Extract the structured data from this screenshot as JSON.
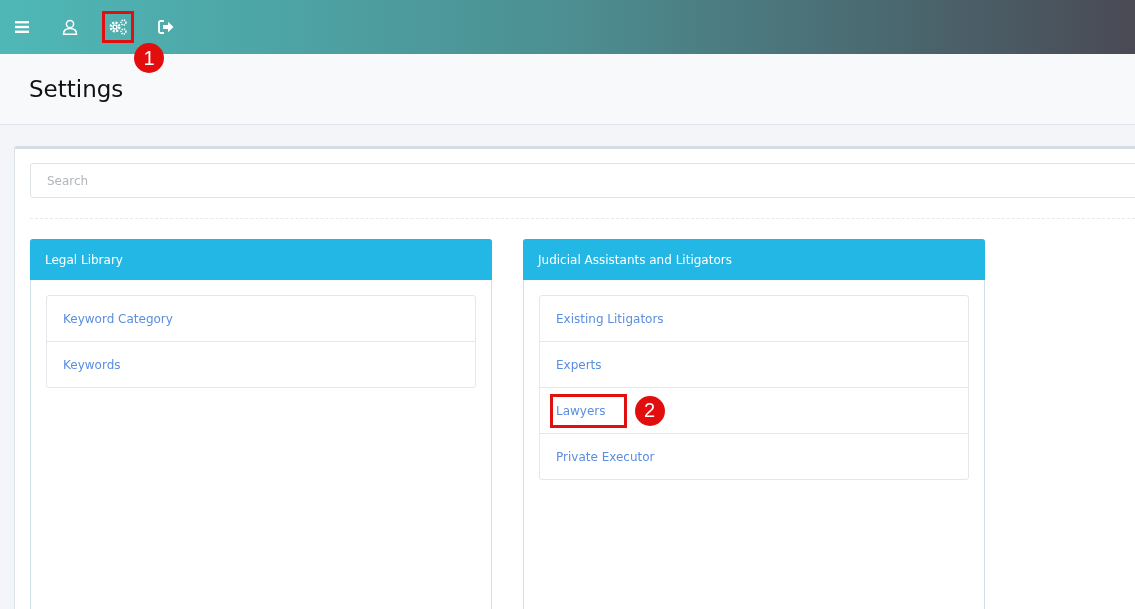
{
  "toolbar": [
    {
      "kind": "menu",
      "highlighted": false
    },
    {
      "kind": "user",
      "highlighted": false
    },
    {
      "kind": "settings",
      "highlighted": true,
      "callout": "1"
    },
    {
      "kind": "logout",
      "highlighted": false
    }
  ],
  "page_title": "Settings",
  "search": {
    "placeholder": "Search"
  },
  "panels": [
    {
      "title": "Legal Library",
      "items": [
        {
          "label": "Keyword Category",
          "highlighted": false
        },
        {
          "label": "Keywords",
          "highlighted": false
        }
      ]
    },
    {
      "title": "Judicial Assistants and Litigators",
      "items": [
        {
          "label": "Existing Litigators",
          "highlighted": false
        },
        {
          "label": "Experts",
          "highlighted": false
        },
        {
          "label": "Lawyers",
          "highlighted": true,
          "callout": "2"
        },
        {
          "label": "Private Executor",
          "highlighted": false
        }
      ]
    }
  ]
}
